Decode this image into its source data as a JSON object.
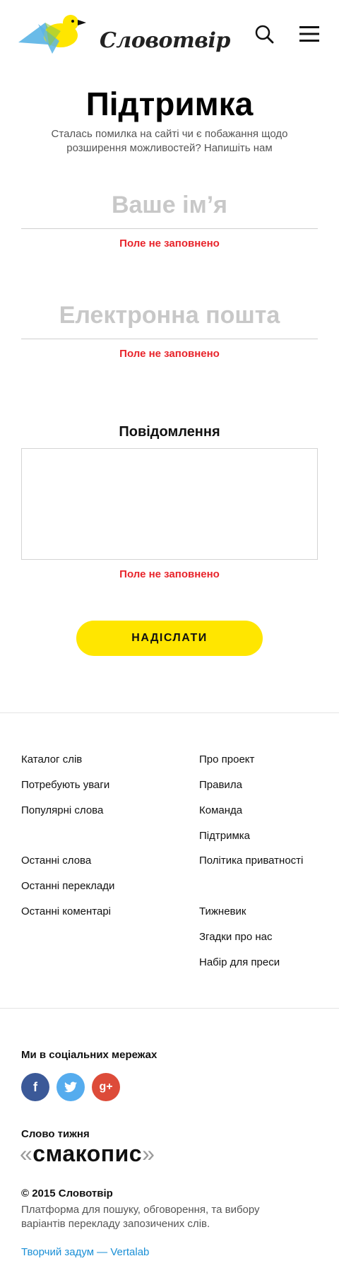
{
  "header": {
    "logo_text": "Словотвір",
    "colors": {
      "bird_blue": "#5ab4e6",
      "bird_yellow": "#ffe600"
    }
  },
  "page": {
    "title": "Підтримка",
    "subtitle": "Сталась помилка на сайті чи є побажання щодо розширення можливостей? Напишіть нам"
  },
  "form": {
    "name_placeholder": "Ваше ім’я",
    "email_placeholder": "Електронна пошта",
    "message_label": "Повідомлення",
    "error_text": "Поле не заповнено",
    "submit_label": "НАДІСЛАТИ",
    "colors": {
      "error": "#e8242b",
      "button": "#ffe600"
    }
  },
  "footer": {
    "left_links": [
      "Каталог слів",
      "Потребують уваги",
      "Популярні слова",
      "Останні слова",
      "Останні переклади",
      "Останні коментарі"
    ],
    "right_links": [
      "Про проект",
      "Правила",
      "Команда",
      "Підтримка",
      "Політика приватності",
      "Тижневик",
      "Згадки про нас",
      "Набір для преси"
    ],
    "social_title": "Ми в соціальних мережах",
    "social": [
      {
        "icon": "facebook-icon",
        "glyph": "f",
        "color": "#3b5998"
      },
      {
        "icon": "twitter-icon",
        "glyph": "t",
        "color": "#55acee"
      },
      {
        "icon": "google-plus-icon",
        "glyph": "g+",
        "color": "#dd4b39"
      }
    ],
    "word_of_week_label": "Слово тижня",
    "word_of_week": "смакопис",
    "quote_open": "«",
    "quote_close": "»",
    "copyright": "© 2015 Словотвір",
    "description": "Платформа для пошуку, обговорення, та вибору варіантів перекладу запозичених слів.",
    "credit": "Творчий задум — Vertalab",
    "credit_color": "#1a8fd6"
  }
}
